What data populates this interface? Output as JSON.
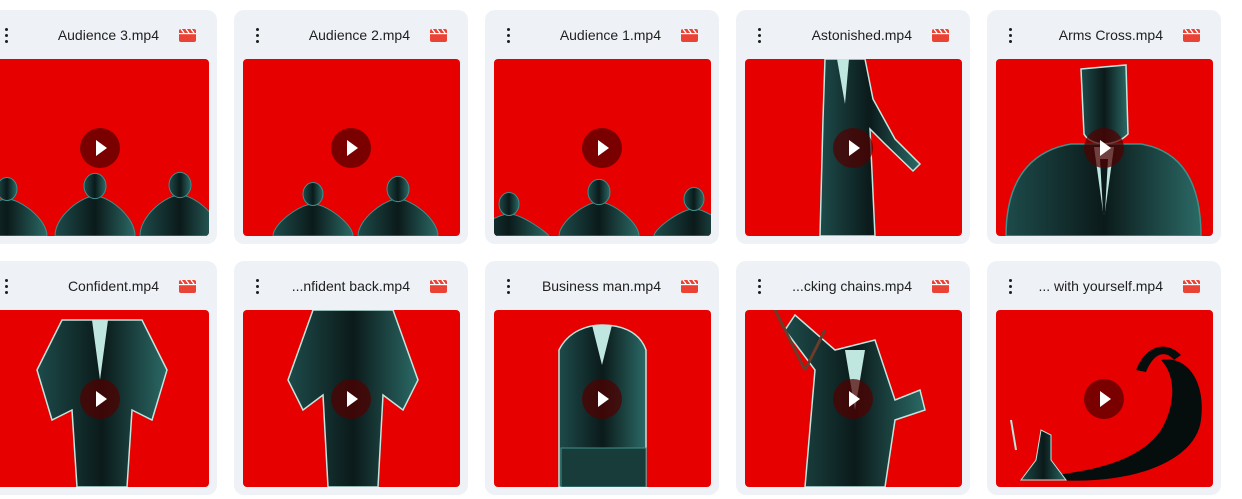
{
  "files": [
    {
      "name": "Audience 3.mp4",
      "scene": "audience-a"
    },
    {
      "name": "Audience 2.mp4",
      "scene": "audience-b"
    },
    {
      "name": "Audience 1.mp4",
      "scene": "audience-c"
    },
    {
      "name": "Astonished.mp4",
      "scene": "astonished"
    },
    {
      "name": "Arms Cross.mp4",
      "scene": "arms-cross"
    },
    {
      "name": "Confident.mp4",
      "scene": "confident"
    },
    {
      "name": "...nfident back.mp4",
      "scene": "confident-back"
    },
    {
      "name": "Business man.mp4",
      "scene": "business-man"
    },
    {
      "name": "...cking chains.mp4",
      "scene": "chains"
    },
    {
      "name": "... with yourself.mp4",
      "scene": "shadow"
    }
  ],
  "icons": {
    "more": "more-vert-icon",
    "file_type": "video-file-icon",
    "play": "play-icon"
  },
  "colors": {
    "card_bg": "#eef1f6",
    "thumb_red": "#e60000",
    "video_icon": "#ea4335",
    "text": "#1f1f1f"
  }
}
